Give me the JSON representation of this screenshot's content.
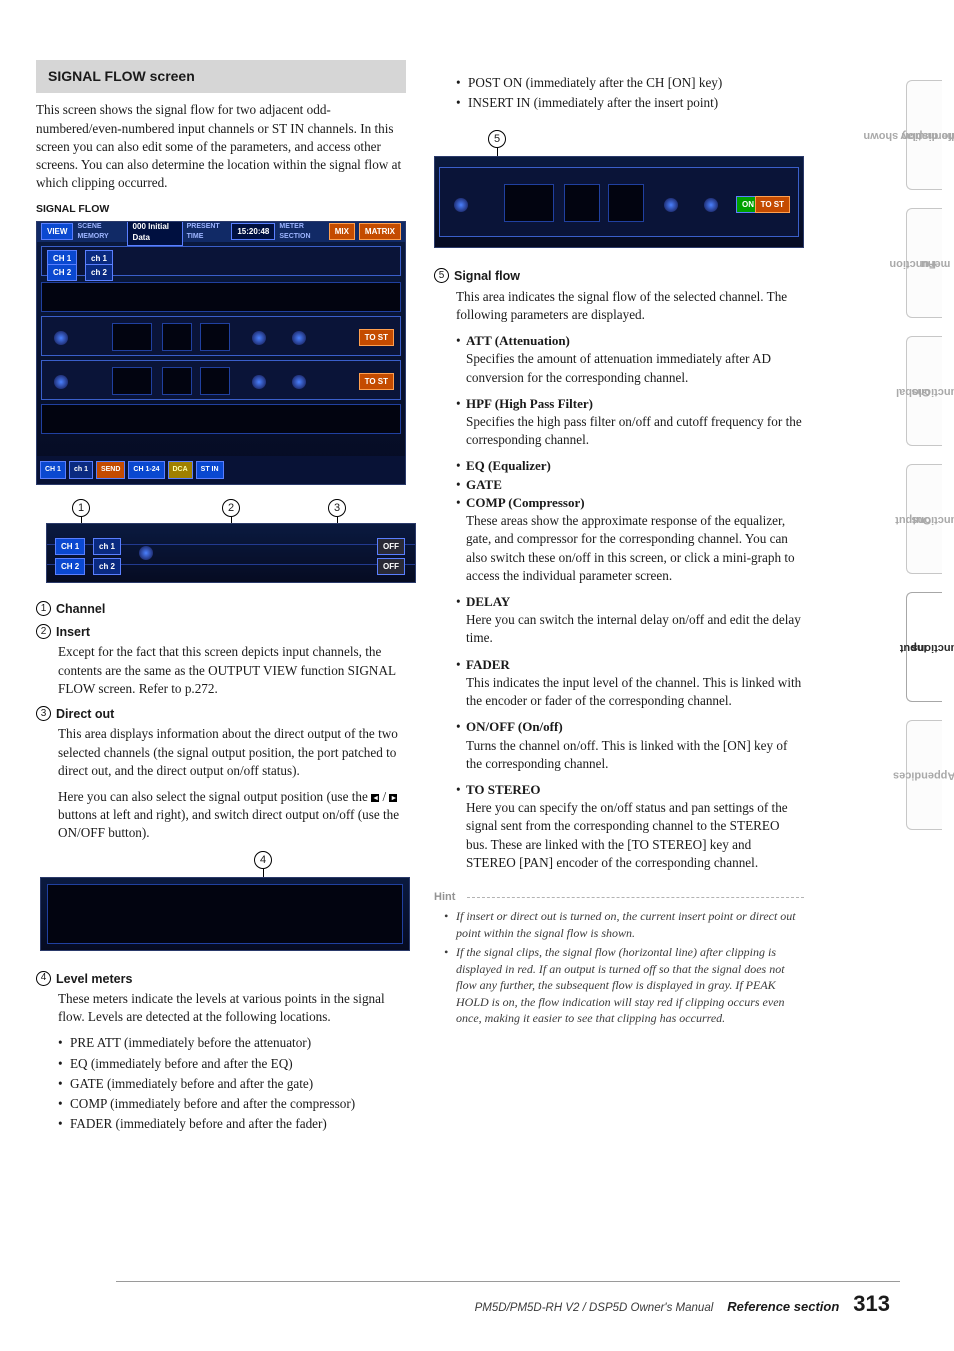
{
  "header": {
    "title": "SIGNAL FLOW screen"
  },
  "intro": "This screen shows the signal flow for two adjacent odd-numbered/even-numbered input channels or ST IN channels. In this screen you can also edit some of the parameters, and access other screens. You can also determine the location within the signal flow at which clipping occurred.",
  "caption1": "SIGNAL FLOW",
  "callouts_strip1": {
    "c1": "1",
    "c2": "2",
    "c3": "3"
  },
  "items_left": {
    "i1": {
      "num": "1",
      "label": "Channel"
    },
    "i2": {
      "num": "2",
      "label": "Insert",
      "body": "Except for the fact that this screen depicts input channels, the contents are the same as the OUTPUT VIEW function SIGNAL FLOW screen. Refer to p.272."
    },
    "i3": {
      "num": "3",
      "label": "Direct out",
      "body1": "This area displays information about the direct output of the two selected channels (the signal output position, the port patched to direct out, and the direct output on/off status).",
      "body2a": "Here you can also select the signal output position (use the ",
      "body2b": " / ",
      "body2c": " buttons at left and right), and switch direct output on/off (use the ON/OFF button)."
    }
  },
  "callouts_strip2": {
    "c4": "4"
  },
  "items_left2": {
    "i4": {
      "num": "4",
      "label": "Level meters",
      "body": "These meters indicate the levels at various points in the signal flow. Levels are detected at the following locations.",
      "bullets": [
        "PRE ATT (immediately before the attenuator)",
        "EQ (immediately before and after the EQ)",
        "GATE (immediately before and after the gate)",
        "COMP (immediately before and after the compressor)",
        "FADER (immediately before and after the fader)"
      ]
    }
  },
  "right_bullets_top": [
    "POST ON (immediately after the CH [ON] key)",
    "INSERT IN (immediately after the insert point)"
  ],
  "callouts_stripR": {
    "c5": "5"
  },
  "items_right": {
    "i5": {
      "num": "5",
      "label": "Signal flow",
      "body": "This area indicates the signal flow of the selected channel. The following parameters are displayed."
    }
  },
  "params": [
    {
      "name": "ATT (Attenuation)",
      "body": "Specifies the amount of attenuation immediately after AD conversion for the corresponding channel."
    },
    {
      "name": "HPF (High Pass Filter)",
      "body": "Specifies the high pass filter on/off and cutoff frequency for the corresponding channel."
    },
    {
      "name": "EQ (Equalizer)",
      "body": ""
    },
    {
      "name": "GATE",
      "body": ""
    },
    {
      "name": "COMP (Compressor)",
      "body": "These areas show the approximate response of the equalizer, gate, and compressor for the corresponding channel. You can also switch these on/off in this screen, or click a mini-graph to access the individual parameter screen."
    },
    {
      "name": "DELAY",
      "body": "Here you can switch the internal delay on/off and edit the delay time."
    },
    {
      "name": "FADER",
      "body": "This indicates the input level of the channel. This is linked with the encoder or fader of the corresponding channel."
    },
    {
      "name": "ON/OFF (On/off)",
      "body": "Turns the channel on/off. This is linked with the [ON] key of the corresponding channel."
    },
    {
      "name": "TO STEREO",
      "body": "Here you can specify the on/off status and pan settings of the signal sent from the corresponding channel to the STEREO bus. These are linked with the [TO STEREO] key and STEREO [PAN] encoder of the corresponding channel."
    }
  ],
  "hint_label": "Hint",
  "hints": [
    "If insert or direct out is turned on, the current insert point or direct out point within the signal flow is shown.",
    "If the signal clips, the signal flow (horizontal line) after clipping is displayed in red. If an output is turned off so that the signal does not flow any further, the subsequent flow is displayed in gray. If PEAK HOLD is on, the flow indication will stay red if clipping occurs even once, making it easier to see that clipping has occurred."
  ],
  "tabs": [
    {
      "l1": "Information shown",
      "l2": "in the display"
    },
    {
      "l1": "Function",
      "l2": "menu"
    },
    {
      "l1": "Global",
      "l2": "functions"
    },
    {
      "l1": "Output",
      "l2": "functions"
    },
    {
      "l1": "Input",
      "l2": "functions"
    },
    {
      "l1": "Appendices",
      "l2": ""
    }
  ],
  "tabs_active_index": 4,
  "footer": {
    "book": "PM5D/PM5D-RH V2 / DSP5D Owner's Manual",
    "section": "Reference section",
    "page": "313"
  },
  "fig_big": {
    "view": "VIEW",
    "scene": "000 Initial Data",
    "scene_lbl": "SCENE MEMORY",
    "time_lbl": "PRESENT TIME",
    "time": "15:20:48",
    "meter_lbl": "METER SECTION",
    "mix": "MIX",
    "matrix": "MATRIX",
    "ch1": "CH 1",
    "ch1b": "ch 1",
    "ch2": "CH 2",
    "ch2b": "ch 2",
    "btm_send": "SEND",
    "btm_ch": "CH 1-24",
    "btm_dca": "DCA",
    "btm_stin": "ST IN"
  },
  "fig_strip1": {
    "ch1": "CH 1",
    "ch1b": "ch 1",
    "ch2": "CH 2",
    "ch2b": "ch 2",
    "off": "OFF"
  }
}
